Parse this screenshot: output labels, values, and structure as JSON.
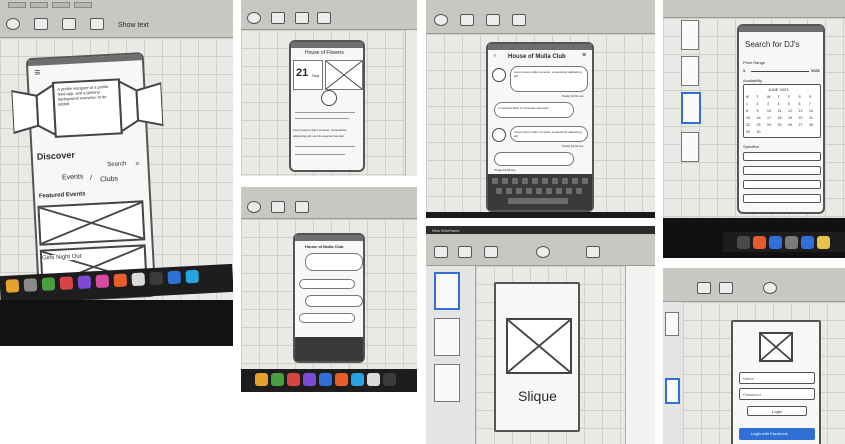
{
  "collage": {
    "photo1": {
      "screen_title": "Discover",
      "search_label": "Search",
      "tabs": [
        "Events",
        "/",
        "Clubs"
      ],
      "section_heading": "Featured Events",
      "event_title": "Girls Night Out",
      "hero_note": "A profile marquee of a profile feed app, and a general background overview, to be added",
      "toolbar_label": "Show text"
    },
    "photo2": {
      "screen_title": "House of Flowers",
      "date_number": "21",
      "date_month": "Sep",
      "body_lines": [
        "Lorem ipsum dolor sit amet, consectetur",
        "adipiscing elit, sed do eiusmod tempor"
      ]
    },
    "photo3": {
      "screen_title": "House of Mulla Club",
      "time_stamps": [
        "Today 10:01 am",
        "Today 10:02 am",
        "Today 10:03 am"
      ],
      "message_lines": [
        "Lorem ipsum dolor sit amet, consectetur adipiscing elit",
        "In reprehenderit in voluptate velit esse",
        "Lorem ipsum dolor sit amet, consectetur adipiscing elit"
      ]
    },
    "photo4": {
      "screen_title": "Search for DJ's",
      "price_label": "Price Range",
      "price_min": "$",
      "price_max": "$$$$",
      "availability_label": "Availability",
      "month_label": "JUNE 2023",
      "specifics_label": "Specifics",
      "days": [
        "M",
        "T",
        "W",
        "T",
        "F",
        "S",
        "S"
      ],
      "dates": [
        "1",
        "2",
        "3",
        "4",
        "5",
        "6",
        "7",
        "8",
        "9",
        "10",
        "11",
        "12",
        "13",
        "14",
        "15",
        "16",
        "17",
        "18",
        "19",
        "20",
        "21",
        "22",
        "23",
        "24",
        "25",
        "26",
        "27",
        "28",
        "29",
        "30"
      ]
    },
    "photo5": {
      "screen_title": "House of Mulla Club"
    },
    "photo6": {
      "app_name": "Slique",
      "window_title": "New Wireframe"
    },
    "photo7": {
      "username_label": "Name",
      "password_label": "Password",
      "login_label": "Login",
      "facebook_label": "Login with Facebook"
    },
    "colors": {
      "accent_blue": "#2f6fd6",
      "toolbar_gray": "#c9c7c2",
      "canvas_gray": "#e9e9e6",
      "dock_black": "#1d1d1d"
    }
  }
}
